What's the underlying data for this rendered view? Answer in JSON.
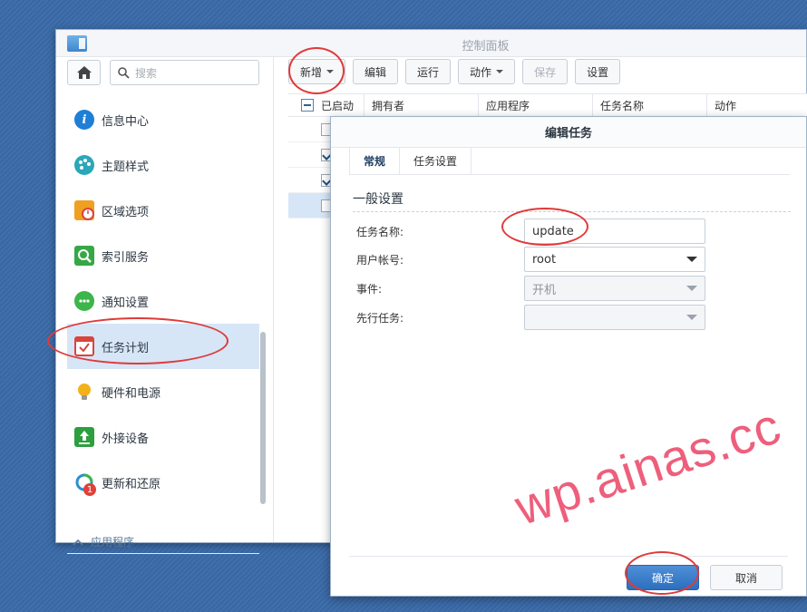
{
  "window": {
    "title": "控制面板"
  },
  "sidebar": {
    "search_placeholder": "搜索",
    "items": [
      {
        "label": "信息中心",
        "icon": "info-icon",
        "color": "#1f7fd6"
      },
      {
        "label": "主题样式",
        "icon": "palette-icon",
        "color": "#2aa7b8"
      },
      {
        "label": "区域选项",
        "icon": "region-clock-icon",
        "color": "#f0a020"
      },
      {
        "label": "索引服务",
        "icon": "index-search-icon",
        "color": "#35a845"
      },
      {
        "label": "通知设置",
        "icon": "chat-bubble-icon",
        "color": "#3cb54a"
      },
      {
        "label": "任务计划",
        "icon": "calendar-check-icon",
        "color": "#d9453c"
      },
      {
        "label": "硬件和电源",
        "icon": "lightbulb-icon",
        "color": "#f2b21b"
      },
      {
        "label": "外接设备",
        "icon": "upload-icon",
        "color": "#2e9e3e"
      },
      {
        "label": "更新和还原",
        "icon": "update-icon",
        "color": "#2b8fd0",
        "badge": "1"
      }
    ],
    "active_index": 5,
    "section_label": "应用程序"
  },
  "toolbar": {
    "new": "新增",
    "edit": "编辑",
    "run": "运行",
    "action": "动作",
    "save": "保存",
    "settings": "设置"
  },
  "grid": {
    "columns": [
      "已启动",
      "拥有者",
      "应用程序",
      "任务名称",
      "动作"
    ],
    "rows_checked": [
      false,
      true,
      true,
      false
    ]
  },
  "dialog": {
    "title": "编辑任务",
    "tabs": [
      "常规",
      "任务设置"
    ],
    "section": "一般设置",
    "fields": {
      "task_name_label": "任务名称:",
      "task_name_value": "update",
      "user_label": "用户帐号:",
      "user_value": "root",
      "event_label": "事件:",
      "event_value": "开机",
      "pre_task_label": "先行任务:",
      "pre_task_value": ""
    },
    "ok": "确定",
    "cancel": "取消"
  },
  "watermark": "wp.ainas.cc"
}
